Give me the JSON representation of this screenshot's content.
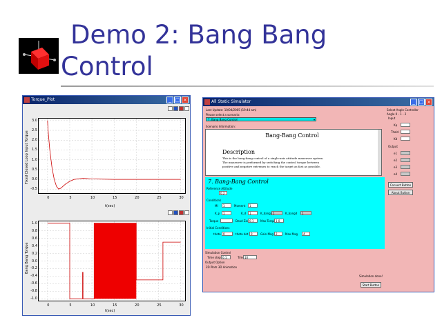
{
  "slide": {
    "title_line1": "Demo 2: Bang Bang",
    "title_line2": "Control"
  },
  "plot_window": {
    "title": "Torque_Plot",
    "top_plot": {
      "ylabel": "Fixed Closed Loop Input Torque",
      "xlabel": "t(sec)",
      "yticks": [
        "3.0",
        "2.5",
        "2.0",
        "1.5",
        "1.0",
        "0.5",
        "0.0",
        "-0.5"
      ],
      "xticks": [
        "0",
        "5",
        "10",
        "15",
        "20",
        "25",
        "30"
      ]
    },
    "bottom_plot": {
      "ylabel": "Bang Bang Torque",
      "xlabel": "t(sec)",
      "yticks": [
        "1.0",
        "0.8",
        "0.6",
        "0.4",
        "0.2",
        "0.0",
        "-0.2",
        "-0.4",
        "-0.6",
        "-0.8",
        "-1.0"
      ],
      "xticks": [
        "0",
        "5",
        "10",
        "15",
        "20",
        "25",
        "30"
      ]
    }
  },
  "chart_data": [
    {
      "type": "line",
      "title": "",
      "ylabel": "Fixed Closed Loop Input Torque",
      "xlabel": "t(sec)",
      "xlim": [
        -2,
        31
      ],
      "ylim": [
        -0.7,
        3.1
      ],
      "grid": true,
      "series": [
        {
          "color": "#cc0000",
          "x": [
            0,
            0.2,
            0.5,
            1,
            1.5,
            2,
            2.5,
            3,
            4,
            5,
            6,
            8,
            10,
            15,
            20,
            25,
            30
          ],
          "y": [
            3.0,
            2.3,
            1.5,
            0.6,
            0.0,
            -0.35,
            -0.5,
            -0.45,
            -0.25,
            -0.1,
            0.0,
            0.05,
            0.02,
            0.0,
            0.0,
            0.0,
            0.0
          ]
        }
      ]
    },
    {
      "type": "line",
      "title": "",
      "ylabel": "Bang Bang Torque",
      "xlabel": "t(sec)",
      "xlim": [
        -2,
        31
      ],
      "ylim": [
        -1.05,
        1.05
      ],
      "grid": true,
      "series": [
        {
          "color": "#cc0000",
          "x": [
            0,
            5,
            5,
            7.9,
            7.9,
            8,
            8,
            10.5,
            10.5,
            20,
            20,
            26,
            26,
            30
          ],
          "y": [
            1,
            1,
            -1,
            -1,
            -0.3,
            -0.3,
            -1,
            -1,
            1,
            1,
            -0.5,
            -0.5,
            0.5,
            0.5
          ]
        },
        {
          "color": "#ee0000",
          "fill_between": [
            10.5,
            20
          ],
          "y_range": [
            -1,
            1
          ]
        }
      ]
    }
  ],
  "simulator": {
    "title": "All Static Simulator",
    "header_line1": "Last Update: 10/04/2005 (19:44 am)",
    "header_line2": "Please select a scenario:",
    "dropdown_value": "7. Bang Bang Control",
    "info_label": "Scenario Information:",
    "doc_title": "Bang-Bang Control",
    "doc_heading": "Description",
    "doc_text1": "This is the bang-bang control of a single-axis attitude maneuver system.",
    "doc_text2": "The maneuver is performed by switching the control torque between",
    "doc_text3": "positive and negative extremes to reach the target as fast as possible.",
    "panel_title": "7. Bang-Bang Control",
    "reference_label": "Reference Attitude",
    "reference_value": "0.2",
    "conditions_label": "Conditions",
    "cond_labels": [
      "MI",
      "Moment",
      "K_p",
      "K_d",
      "K_bangp",
      "K_bangd"
    ],
    "cond_values": [
      "1",
      "1",
      "1",
      "1",
      "1",
      "1"
    ],
    "torque_label": "Torque",
    "dead_zone_label": "Dead Zone",
    "dead_zone_value": "0.1",
    "max_torque_label": "Max Torque",
    "max_torque_value": "1.0",
    "init_label": "Initial Conditions",
    "init_fields": [
      "theta",
      "theta dot",
      "Gain Mag",
      "Max Mag"
    ],
    "init_values": [
      "0",
      "0",
      "2",
      "4"
    ],
    "sim_control_label": "Simulation Control",
    "time_step_label": "Time step",
    "time_step_value": "0.1",
    "time_label": "Time",
    "time_value": "10",
    "output_label": "Output Option",
    "output_option": "2D Plots  3D Animation",
    "status": "Simulation done!",
    "start_button": "Start Button",
    "side_title": "Select Angle Controller",
    "side_sub": "Angle  0 - 1 - 2",
    "input_label": "Input",
    "input_fields": [
      "Kp",
      "Thold",
      "Kd"
    ],
    "output_label2": "Output",
    "output_fields": [
      "e1",
      "e2",
      "e3",
      "e4"
    ],
    "convert_button": "Convert Button",
    "about_button": "About Button"
  }
}
